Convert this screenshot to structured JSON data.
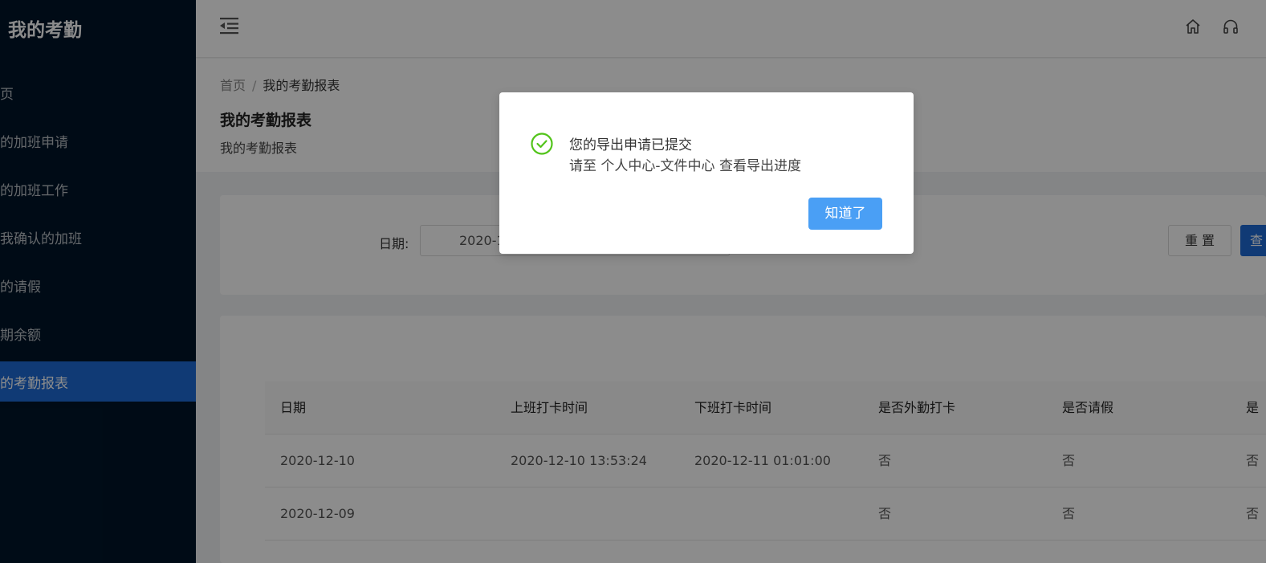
{
  "sidebar": {
    "title": "我的考勤",
    "items": [
      {
        "label": "首页"
      },
      {
        "label": "我的加班申请"
      },
      {
        "label": "我的加班工作"
      },
      {
        "label": "待我确认的加班"
      },
      {
        "label": "我的请假"
      },
      {
        "label": "假期余额"
      },
      {
        "label": "我的考勤报表",
        "active": true
      }
    ]
  },
  "header": {
    "fold_icon": "menu-fold-icon",
    "home_icon": "home-icon",
    "support_icon": "headset-icon"
  },
  "breadcrumb": {
    "home": "首页",
    "separator": "/",
    "current": "我的考勤报表"
  },
  "page": {
    "title": "我的考勤报表",
    "subtitle": "我的考勤报表"
  },
  "filter": {
    "date_label": "日期:",
    "date_value": "2020-1",
    "reset_label": "重 置",
    "query_label": "查"
  },
  "table": {
    "columns": [
      "日期",
      "上班打卡时间",
      "下班打卡时间",
      "是否外勤打卡",
      "是否请假",
      "是"
    ],
    "rows": [
      [
        "2020-12-10",
        "2020-12-10 13:53:24",
        "2020-12-11 01:01:00",
        "否",
        "否",
        "否"
      ],
      [
        "2020-12-09",
        "",
        "",
        "否",
        "否",
        "否"
      ]
    ]
  },
  "modal": {
    "icon": "check-circle-icon",
    "title": "您的导出申请已提交",
    "content": "请至 个人中心-文件中心 查看导出进度",
    "ok_label": "知道了"
  },
  "colors": {
    "sidebar_bg": "#001529",
    "accent": "#1e6bd6",
    "success": "#52c41a",
    "ok_button": "#4a9ff5"
  }
}
